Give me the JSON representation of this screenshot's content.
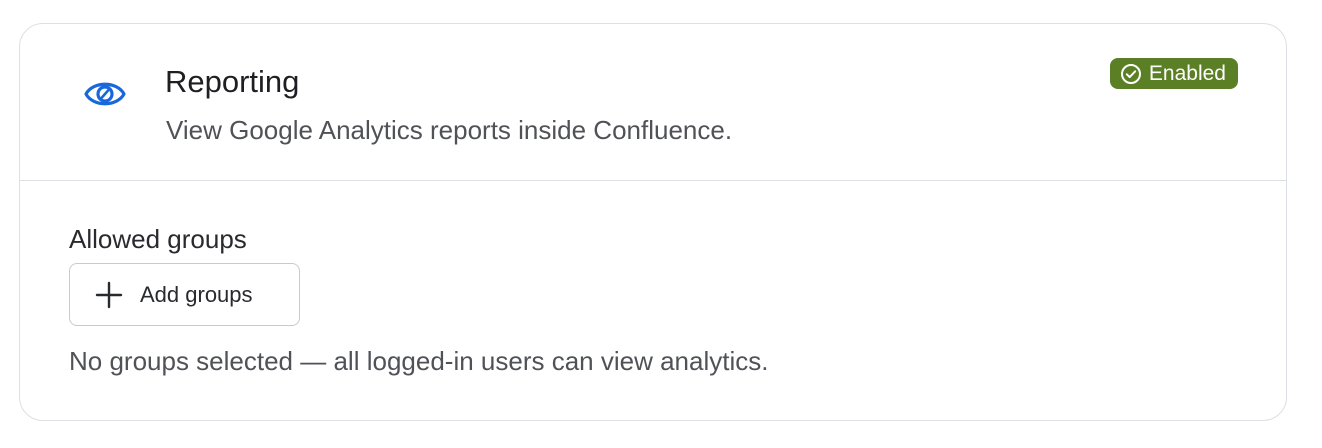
{
  "card": {
    "title": "Reporting",
    "description": "View Google Analytics reports inside Confluence.",
    "header_icon": "eye-icon",
    "status": {
      "label": "Enabled",
      "icon": "check-circle-icon",
      "color": "#5b7f24"
    }
  },
  "allowed_groups": {
    "label": "Allowed groups",
    "add_button_label": "Add groups",
    "add_button_icon": "plus-icon",
    "helper_text": "No groups selected — all logged-in users can view analytics."
  },
  "colors": {
    "accent_icon": "#1868db",
    "border": "#dcdfe4",
    "text_primary": "#292a2e",
    "text_secondary": "#505258"
  }
}
